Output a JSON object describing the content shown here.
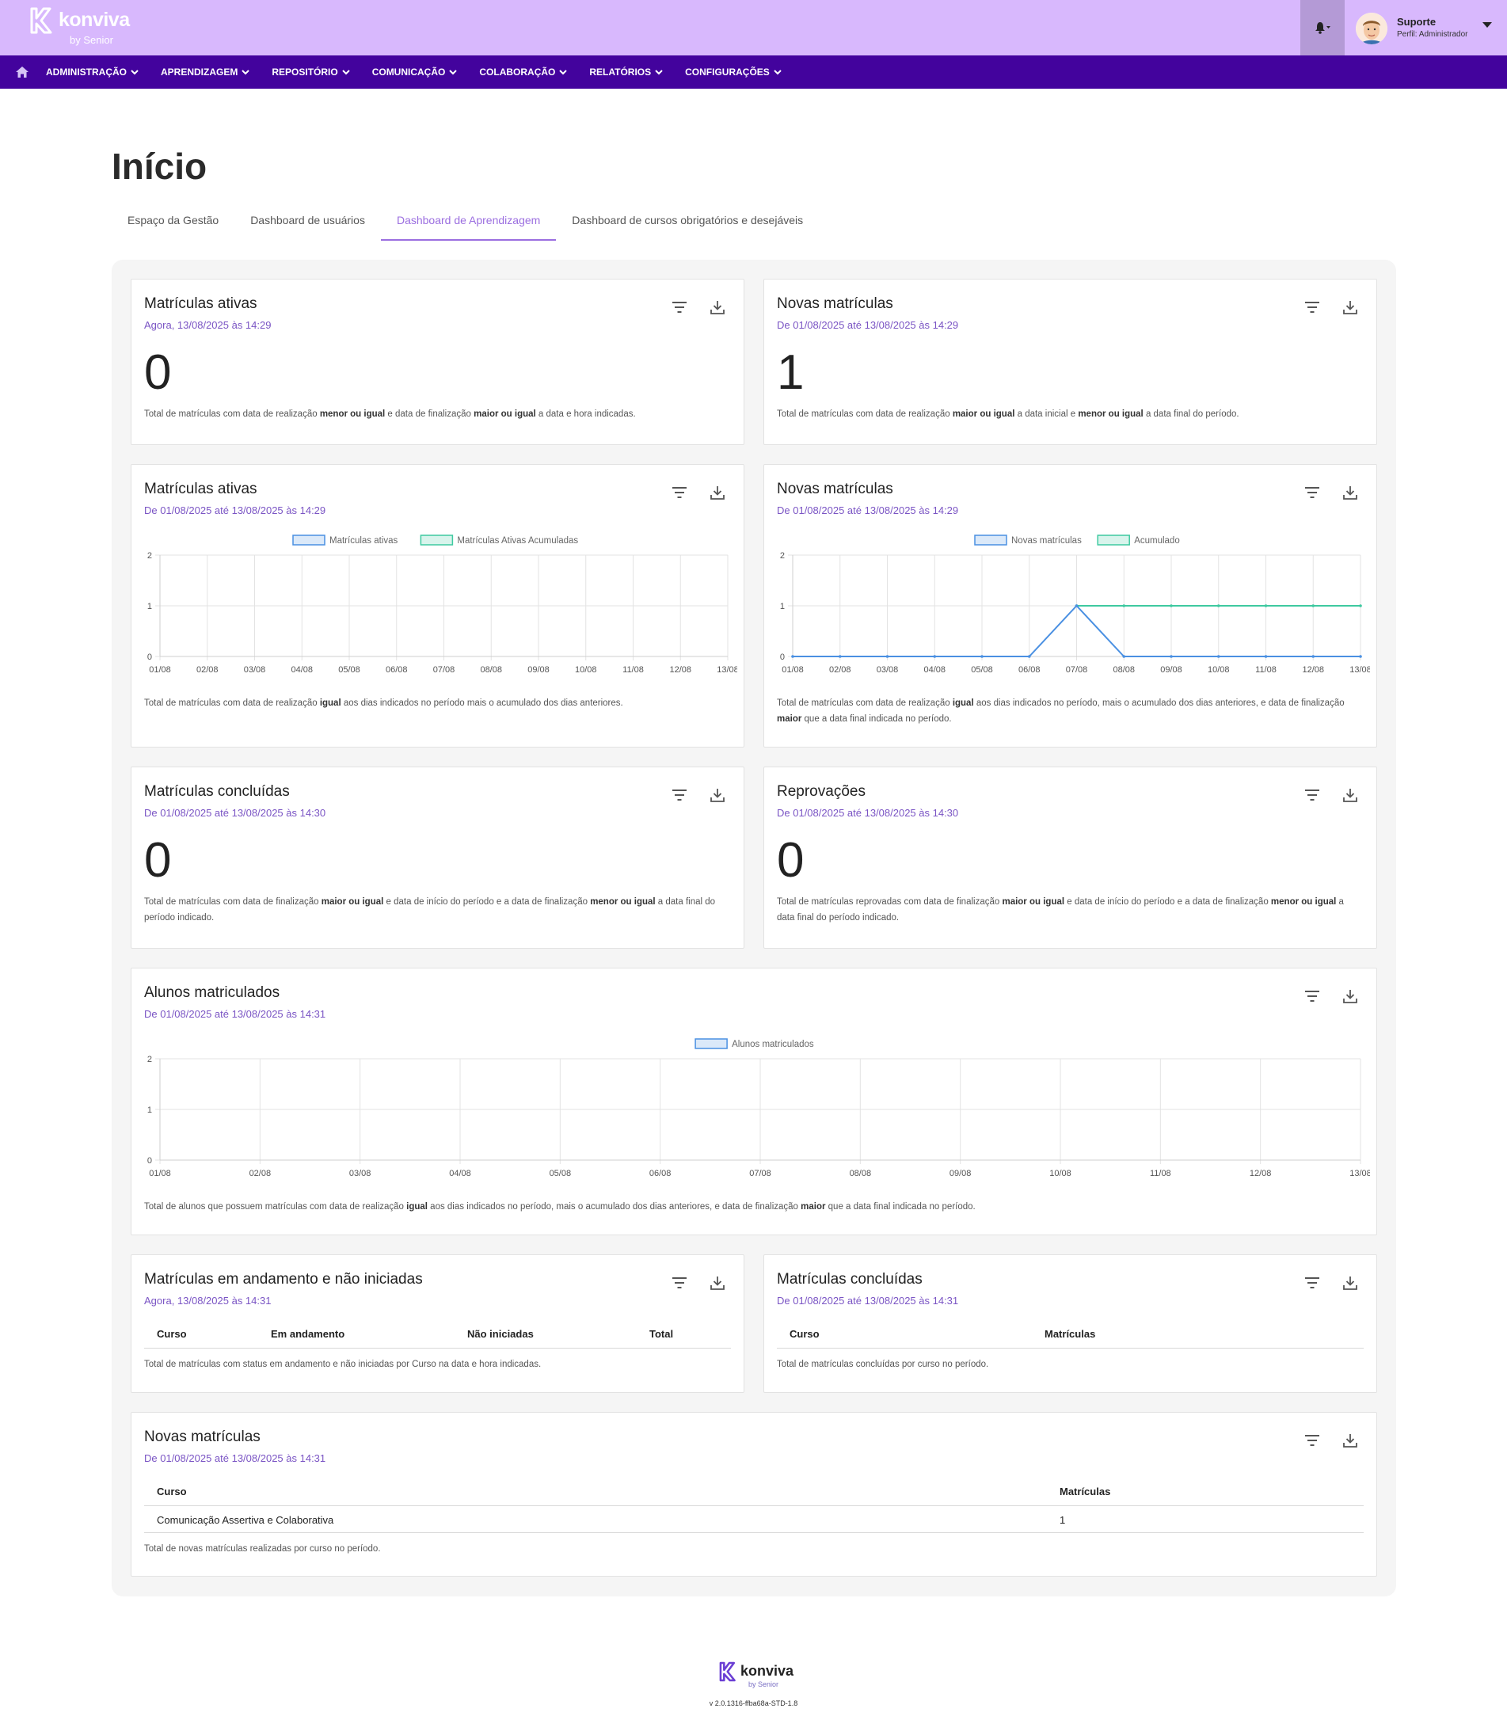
{
  "brand": {
    "name": "konviva",
    "by": "by Senior"
  },
  "user": {
    "name": "Suporte",
    "profile": "Perfil: Administrador"
  },
  "nav": {
    "items": [
      {
        "label": "ADMINISTRAÇÃO"
      },
      {
        "label": "APRENDIZAGEM"
      },
      {
        "label": "REPOSITÓRIO"
      },
      {
        "label": "COMUNICAÇÃO"
      },
      {
        "label": "COLABORAÇÃO"
      },
      {
        "label": "RELATÓRIOS"
      },
      {
        "label": "CONFIGURAÇÕES"
      }
    ]
  },
  "page": {
    "title": "Início"
  },
  "tabs": [
    {
      "label": "Espaço da Gestão"
    },
    {
      "label": "Dashboard de usuários"
    },
    {
      "label": "Dashboard de Aprendizagem",
      "active": true
    },
    {
      "label": "Dashboard de cursos obrigatórios e desejáveis"
    }
  ],
  "cards": {
    "active_now": {
      "title": "Matrículas ativas",
      "subtitle": "Agora, 13/08/2025 às 14:29",
      "value": "0",
      "note_parts": [
        "Total de matrículas com data de realização ",
        "menor ou igual",
        " e data de finalização ",
        "maior ou igual",
        " a data e hora indicadas."
      ]
    },
    "new_count": {
      "title": "Novas matrículas",
      "subtitle": "De 01/08/2025 até 13/08/2025 às 14:29",
      "value": "1",
      "note_parts": [
        "Total de matrículas com data de realização ",
        "maior ou igual",
        " a data inicial e ",
        "menor ou igual",
        " a data final do período."
      ]
    },
    "active_chart": {
      "title": "Matrículas ativas",
      "subtitle": "De 01/08/2025 até 13/08/2025 às 14:29",
      "note_parts": [
        "Total de matrículas com data de realização ",
        "igual",
        " aos dias indicados no período mais o acumulado dos dias anteriores."
      ]
    },
    "new_chart": {
      "title": "Novas matrículas",
      "subtitle": "De 01/08/2025 até 13/08/2025 às 14:29",
      "note_parts": [
        "Total de matrículas com data de realização ",
        "igual",
        " aos dias indicados no período, mais o acumulado dos dias anteriores, e data de finalização ",
        "maior",
        " que a data final indicada no período."
      ]
    },
    "completed_count": {
      "title": "Matrículas concluídas",
      "subtitle": "De 01/08/2025 até 13/08/2025 às 14:30",
      "value": "0",
      "note_parts": [
        "Total de matrículas com data de finalização ",
        "maior ou igual",
        " e data de início do período e a data de finalização ",
        "menor ou igual",
        " a data final do período indicado."
      ]
    },
    "failed_count": {
      "title": "Reprovações",
      "subtitle": "De 01/08/2025 até 13/08/2025 às 14:30",
      "value": "0",
      "note_parts": [
        "Total de matrículas reprovadas com data de finalização ",
        "maior ou igual",
        " e data de início do período e a data de finalização ",
        "menor ou igual",
        " a data final do período indicado."
      ]
    },
    "students_chart": {
      "title": "Alunos matriculados",
      "subtitle": "De 01/08/2025 até 13/08/2025 às 14:31",
      "note_parts": [
        "Total de alunos que possuem matrículas com data de realização ",
        "igual",
        " aos dias indicados no período, mais o acumulado dos dias anteriores, e data de finalização ",
        "maior",
        " que a data final indicada no período."
      ]
    },
    "in_progress_table": {
      "title": "Matrículas em andamento e não iniciadas",
      "subtitle": "Agora, 13/08/2025 às 14:31",
      "columns": [
        "Curso",
        "Em andamento",
        "Não iniciadas",
        "Total"
      ],
      "note": "Total de matrículas com status em andamento e não iniciadas por Curso na data e hora indicadas."
    },
    "completed_table": {
      "title": "Matrículas concluídas",
      "subtitle": "De 01/08/2025 até 13/08/2025 às 14:31",
      "columns": [
        "Curso",
        "Matrículas"
      ],
      "note": "Total de matrículas concluídas por curso no período."
    },
    "new_table": {
      "title": "Novas matrículas",
      "subtitle": "De 01/08/2025 até 13/08/2025 às 14:31",
      "columns": [
        "Curso",
        "Matrículas"
      ],
      "rows": [
        {
          "course": "Comunicação Assertiva e Colaborativa",
          "count": "1"
        }
      ],
      "note": "Total de novas matrículas realizadas por curso no período."
    }
  },
  "chart_data": [
    {
      "id": "active_chart",
      "type": "line",
      "categories": [
        "01/08",
        "02/08",
        "03/08",
        "04/08",
        "05/08",
        "06/08",
        "07/08",
        "08/08",
        "09/08",
        "10/08",
        "11/08",
        "12/08",
        "13/08"
      ],
      "series": [
        {
          "name": "Matrículas ativas",
          "values": [],
          "color": "#4a90e2"
        },
        {
          "name": "Matrículas Ativas Acumuladas",
          "values": [],
          "color": "#3ec9a0"
        }
      ],
      "ylim": [
        0,
        2
      ],
      "yticks": [
        "0",
        "1",
        "2"
      ],
      "grid": true,
      "legend": "top-center"
    },
    {
      "id": "new_chart",
      "type": "line",
      "categories": [
        "01/08",
        "02/08",
        "03/08",
        "04/08",
        "05/08",
        "06/08",
        "07/08",
        "08/08",
        "09/08",
        "10/08",
        "11/08",
        "12/08",
        "13/08"
      ],
      "series": [
        {
          "name": "Novas matrículas",
          "values": [
            0,
            0,
            0,
            0,
            0,
            0,
            1,
            0,
            0,
            0,
            0,
            0,
            0
          ],
          "color": "#4a90e2"
        },
        {
          "name": "Acumulado",
          "values": [
            null,
            null,
            null,
            null,
            null,
            null,
            1,
            1,
            1,
            1,
            1,
            1,
            1
          ],
          "color": "#3ec9a0"
        }
      ],
      "ylim": [
        0,
        2
      ],
      "yticks": [
        "0",
        "1",
        "2"
      ],
      "grid": true,
      "legend": "top-center"
    },
    {
      "id": "students_chart",
      "type": "line",
      "categories": [
        "01/08",
        "02/08",
        "03/08",
        "04/08",
        "05/08",
        "06/08",
        "07/08",
        "08/08",
        "09/08",
        "10/08",
        "11/08",
        "12/08",
        "13/08"
      ],
      "series": [
        {
          "name": "Alunos matriculados",
          "values": [],
          "color": "#4a90e2"
        }
      ],
      "ylim": [
        0,
        2
      ],
      "yticks": [
        "0",
        "1",
        "2"
      ],
      "grid": true,
      "legend": "top-center"
    }
  ],
  "footer": {
    "version": "v 2.0.1316-ffba68a-STD-1.8"
  },
  "colors": {
    "topbar": "#d8b8fd",
    "navbar": "#43039d",
    "accent": "#9b6ee0",
    "subtitle": "#7a54c4",
    "series_blue": "#4a90e2",
    "series_green": "#3ec9a0"
  },
  "icons": {
    "filter": "filter-icon",
    "download": "download-icon",
    "bell": "bell-icon",
    "home": "home-icon",
    "chevron": "chevron-down-icon"
  }
}
